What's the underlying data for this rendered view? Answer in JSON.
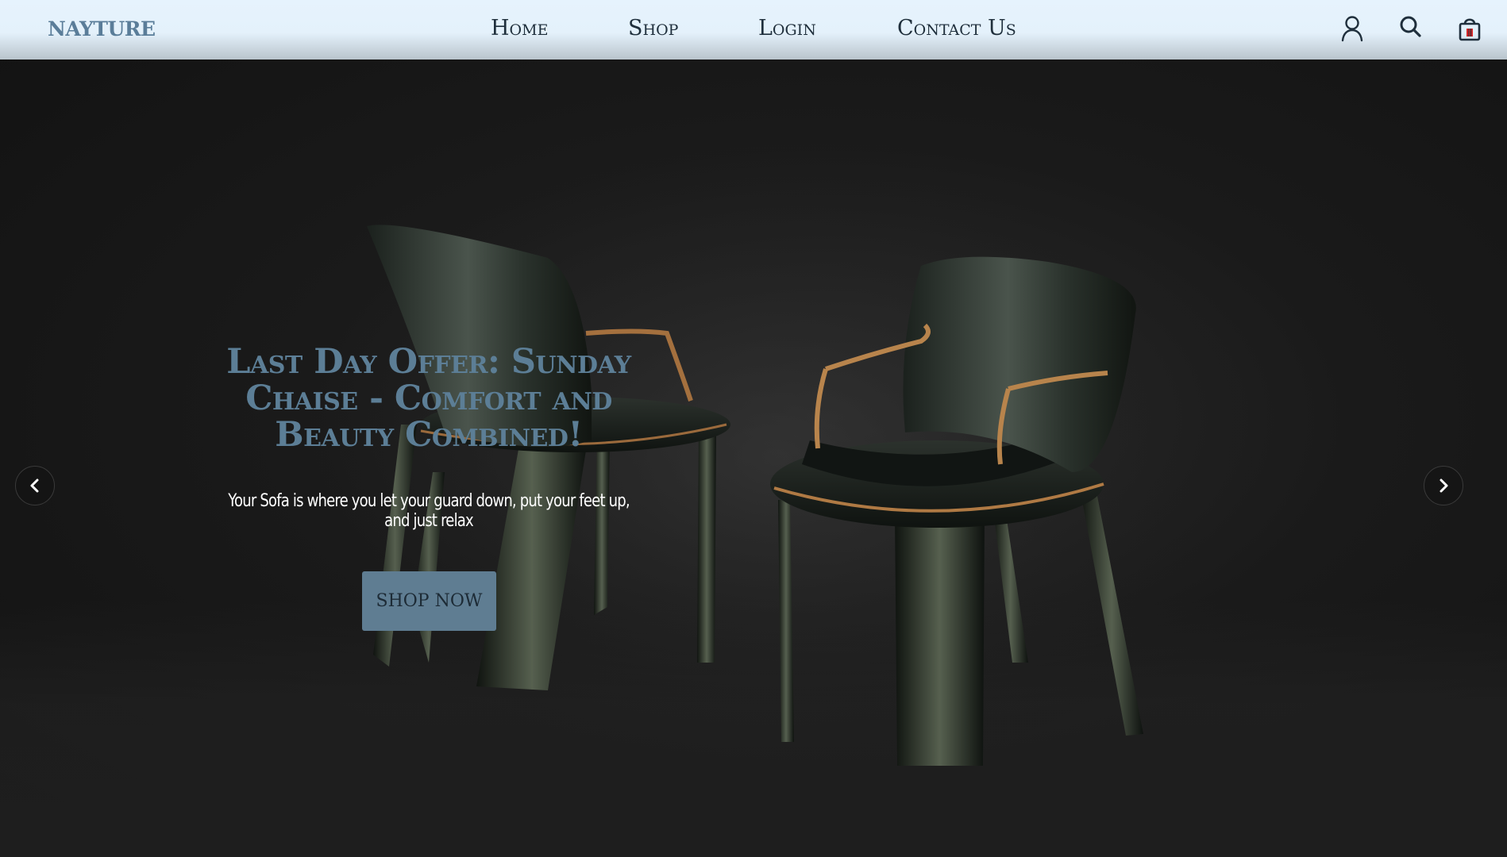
{
  "brand": "NAYTURE",
  "nav": {
    "links": [
      {
        "label": "Home"
      },
      {
        "label": "Shop"
      },
      {
        "label": "Login"
      },
      {
        "label": "Contact Us"
      }
    ],
    "icons": [
      "user-icon",
      "search-icon",
      "shopping-bag-icon"
    ]
  },
  "hero": {
    "title": "Last Day Offer: Sunday Chaise - Comfort and Beauty Combined!",
    "subtitle": "Your Sofa is where you let your guard down, put your feet up, and just relax",
    "cta": "SHOP NOW",
    "prev_icon": "chevron-left-icon",
    "next_icon": "chevron-right-icon"
  },
  "colors": {
    "nav_bg": "#e6f3fd",
    "brand": "#5a7d99",
    "nav_text": "#1f2f3c",
    "hero_bg": "#161616",
    "title": "#5c7e96",
    "cta_bg": "#5f7d92",
    "cart_accent": "#d62828"
  }
}
